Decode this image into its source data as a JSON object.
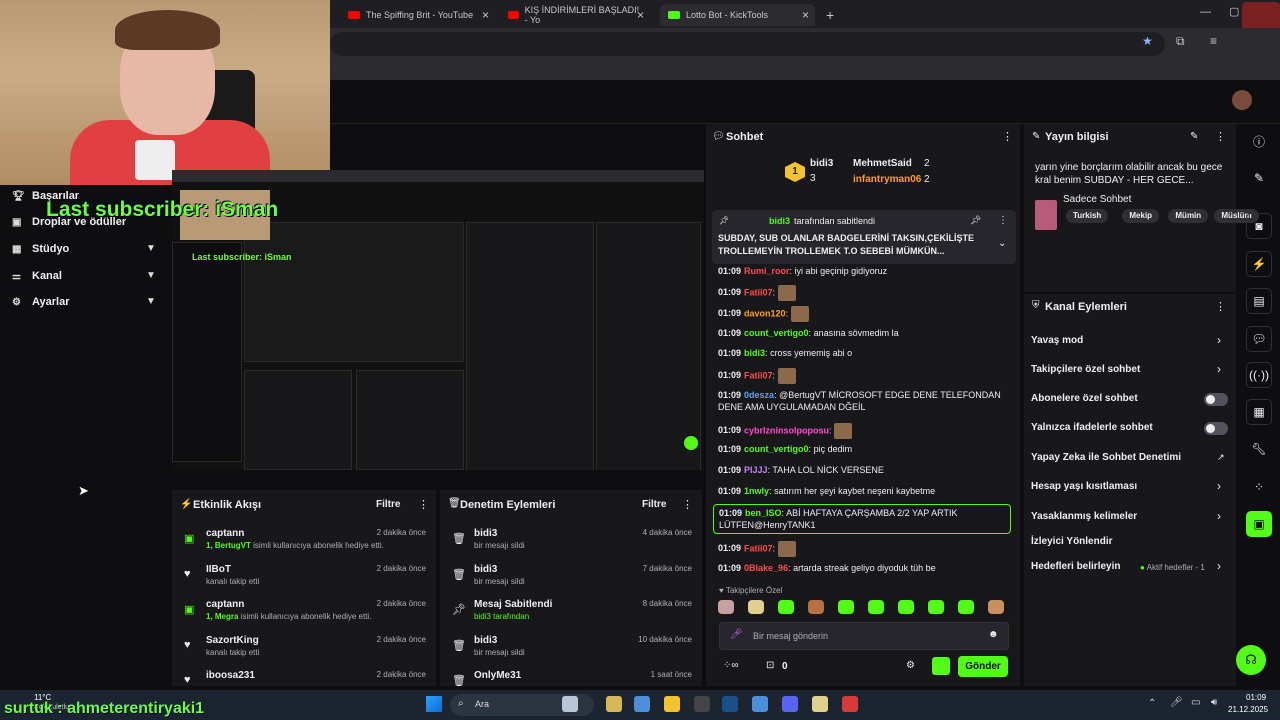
{
  "browser": {
    "tabs": [
      {
        "title": "The Spiffing Brit - YouTube"
      },
      {
        "title": "KIŞ İNDİRİMLERİ BAŞLADI! - Yo"
      },
      {
        "title": "Lotto Bot - KickTools"
      }
    ],
    "new_tab": "+"
  },
  "overlay": {
    "last_subscriber": "Last subscriber: iSman",
    "bottom_name": "surtuk : ahmeterentiryaki1"
  },
  "sidebar": {
    "items": [
      {
        "label": "Başarılar",
        "icon": "trophy-icon"
      },
      {
        "label": "Droplar ve ödüller",
        "icon": "gift-icon"
      },
      {
        "label": "Stüdyo",
        "icon": "grid-icon"
      },
      {
        "label": "Kanal",
        "icon": "sliders-icon"
      },
      {
        "label": "Ayarlar",
        "icon": "gear-icon"
      }
    ]
  },
  "activity": {
    "title": "Etkinlik Akışı",
    "filter": "Filtre",
    "events": [
      {
        "name": "captann",
        "time": "2 dakika önce",
        "prefix": "1, BertugVT",
        "text": " isimli kullanıcıya abonelik hediye etti.",
        "icon": "gift-icon"
      },
      {
        "name": "IIBoT",
        "time": "2 dakika önce",
        "prefix": "",
        "text": "kanalı takip etti",
        "icon": "heart-icon"
      },
      {
        "name": "captann",
        "time": "2 dakika önce",
        "prefix": "1, Megra",
        "text": " isimli kullanıcıya abonelik hediye etti.",
        "icon": "gift-icon"
      },
      {
        "name": "SazortKing",
        "time": "2 dakika önce",
        "prefix": "",
        "text": "kanalı takip etti",
        "icon": "heart-icon"
      },
      {
        "name": "iboosa231",
        "time": "2 dakika önce",
        "prefix": "",
        "text": "",
        "icon": "heart-icon"
      }
    ]
  },
  "moderation": {
    "title": "Denetim Eylemleri",
    "filter": "Filtre",
    "events": [
      {
        "name": "bidi3",
        "time": "4 dakika önce",
        "text": "bir mesajı sildi",
        "icon": "trash-icon"
      },
      {
        "name": "bidi3",
        "time": "7 dakika önce",
        "text": "bir mesajı sildi",
        "icon": "trash-icon"
      },
      {
        "name": "Mesaj Sabitlendi",
        "time": "8 dakika önce",
        "text": "bidi3 tarafından",
        "icon": "pin-icon"
      },
      {
        "name": "bidi3",
        "time": "10 dakika önce",
        "text": "bir mesajı sildi",
        "icon": "trash-icon"
      },
      {
        "name": "OnlyMe31",
        "time": "1 saat önce",
        "text": "",
        "icon": "trash-icon"
      }
    ]
  },
  "chat": {
    "title": "Sohbet",
    "leaders": [
      {
        "rank": "1",
        "name": "bidi3",
        "count": "3"
      },
      {
        "name": "MehmetSaid",
        "count": "2"
      },
      {
        "name": "infantryman06",
        "count": "2"
      }
    ],
    "pinned": {
      "by": "bidi3",
      "by_suffix": "tarafından sabitlendi",
      "text": "SUBDAY, SUB OLANLAR BADGELERİNİ TAKSIN,ÇEKİLİŞTE TROLLEMEYİN TROLLEMEK T.O SEBEBİ MÜMKÜN..."
    },
    "messages": [
      {
        "time": "01:09",
        "user": "Rumi_roor",
        "color": "#ff4d4d",
        "text": "iyi abi geçinip gidiyoruz"
      },
      {
        "time": "01:09",
        "user": "Fatii07",
        "color": "#ff4d4d",
        "text": ""
      },
      {
        "time": "01:09",
        "user": "davon120",
        "color": "#ff9f1a",
        "text": ""
      },
      {
        "time": "01:09",
        "user": "count_vertigo0",
        "color": "#53fc18",
        "text": "anasına sövmedim la"
      },
      {
        "time": "01:09",
        "user": "bidi3",
        "color": "#53fc18",
        "text": "cross yememiş abi o"
      },
      {
        "time": "01:09",
        "user": "Fatii07",
        "color": "#ff4d4d",
        "text": ""
      },
      {
        "time": "01:09",
        "user": "0desza",
        "color": "#4da6ff",
        "text": "@BertugVT MİCROSOFT EDGE DENE TELEFONDAN DENE AMA UYGULAMADAN DĞEİL"
      },
      {
        "time": "01:09",
        "user": "cybrlzninsolpoposu",
        "color": "#ff4dd2",
        "text": ""
      },
      {
        "time": "01:09",
        "user": "count_vertigo0",
        "color": "#53fc18",
        "text": "piç dedim"
      },
      {
        "time": "01:09",
        "user": "PIJJJ",
        "color": "#c77dff",
        "text": "TAHA LOL NİCK VERSENE"
      },
      {
        "time": "01:09",
        "user": "1nwly",
        "color": "#53fc18",
        "text": "satırım her şeyi kaybet neşeni kaybetme"
      },
      {
        "time": "01:09",
        "user": "ben_ISO",
        "color": "#53fc18",
        "text": "ABİ HAFTAYA ÇARŞAMBA 2/2 YAP ARTIK LÜTFEN@HenryTANK1"
      },
      {
        "time": "01:09",
        "user": "Fatii07",
        "color": "#ff4d4d",
        "text": ""
      },
      {
        "time": "01:09",
        "user": "0Blake_96",
        "color": "#ff4d4d",
        "text": "artarda streak geliyo diyoduk tüh be"
      }
    ],
    "followers_only": "Takipçilere Özel",
    "input_placeholder": "Bir mesaj gönderin",
    "points": "0",
    "send": "Gönder"
  },
  "stream_info": {
    "title": "Yayın bilgisi",
    "stream_title": "yarın yine borçlarım olabilir ancak bu gece kral benim SUBDAY - HER GECE...",
    "category": "Sadece Sohbet",
    "tags": [
      "Turkish",
      "Mekip",
      "Mümin",
      "Müslüm"
    ]
  },
  "channel_actions": {
    "title": "Kanal Eylemleri",
    "items": [
      {
        "label": "Yavaş mod",
        "kind": "chevron"
      },
      {
        "label": "Takipçilere özel sohbet",
        "kind": "chevron"
      },
      {
        "label": "Abonelere özel sohbet",
        "kind": "toggle"
      },
      {
        "label": "Yalnızca ifadelerle sohbet",
        "kind": "toggle"
      },
      {
        "label": "Yapay Zeka ile Sohbet Denetimi",
        "kind": "external"
      },
      {
        "label": "Hesap yaşı kısıtlaması",
        "kind": "chevron"
      },
      {
        "label": "Yasaklanmış kelimeler",
        "kind": "chevron"
      },
      {
        "label": "İzleyici Yönlendir",
        "kind": "none"
      },
      {
        "label": "Hedefleri belirleyin",
        "kind": "chevron"
      }
    ],
    "goals_badge": "Aktif hedefler - 1"
  },
  "taskbar": {
    "weather": "11°C",
    "weather_sub": "Çok bulutlu",
    "search": "Ara",
    "time": "01:09",
    "date": "21.12.2025"
  },
  "colors": {
    "accent": "#53fc18",
    "bg": "#0e0e10",
    "panel": "#18181b"
  }
}
